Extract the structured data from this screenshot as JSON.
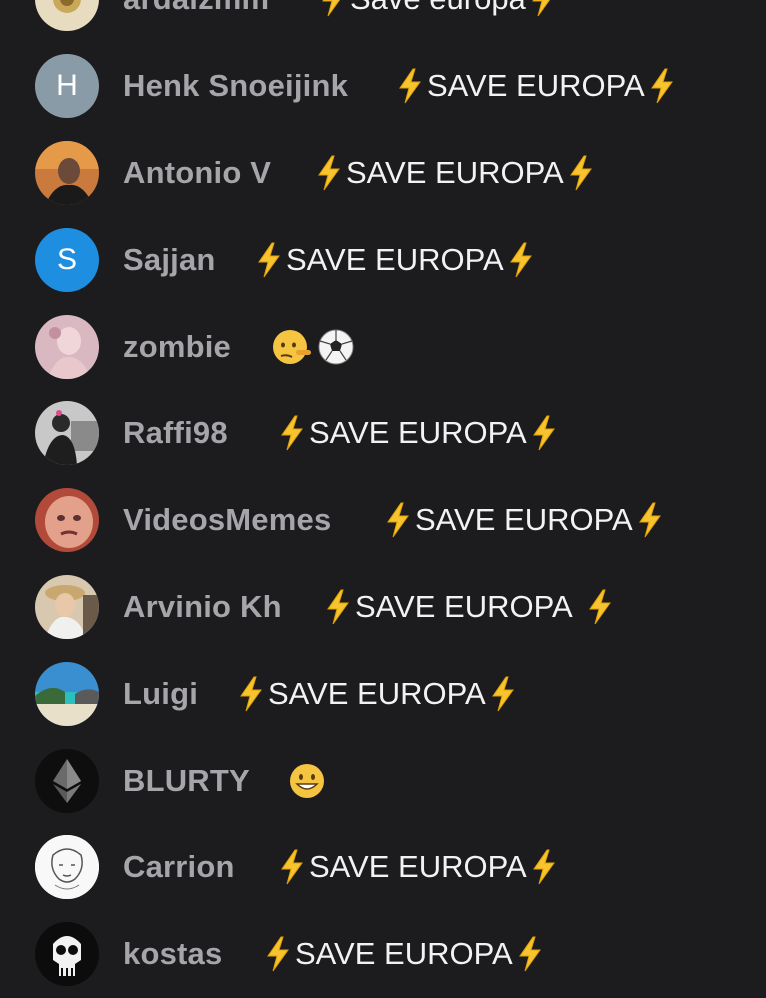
{
  "comments": [
    {
      "name": "ardaizmm",
      "message": "Save europa",
      "avatar": "photo-gold-emblem"
    },
    {
      "name": "Henk Snoeijink",
      "message": "SAVE EUROPA",
      "avatar_letter": "H",
      "avatar_color": "#8a9ba8"
    },
    {
      "name": "Antonio V",
      "message": "SAVE EUROPA",
      "avatar": "photo-man-sunset"
    },
    {
      "name": "Sajjan",
      "message": "SAVE EUROPA",
      "avatar_letter": "S",
      "avatar_color": "#1e8fe0"
    },
    {
      "name": "zombie",
      "emojis": [
        "lying-face-emoji",
        "soccer-ball-emoji"
      ],
      "avatar": "photo-pink"
    },
    {
      "name": "Raffi98",
      "message": "SAVE EUROPA",
      "avatar": "photo-person-car"
    },
    {
      "name": "VideosMemes",
      "message": "SAVE EUROPA",
      "avatar": "photo-baby-face"
    },
    {
      "name": "Arvinio Kh",
      "message": "SAVE EUROPA",
      "avatar": "photo-woman-hat"
    },
    {
      "name": "Luigi",
      "message": "SAVE EUROPA",
      "avatar": "photo-beach"
    },
    {
      "name": "BLURTY",
      "emojis": [
        "grinning-face-emoji"
      ],
      "avatar": "ethereum-logo"
    },
    {
      "name": "Carrion",
      "message": "SAVE EUROPA",
      "avatar": "sketch-drawing"
    },
    {
      "name": "kostas",
      "message": "SAVE EUROPA",
      "avatar": "punisher-skull"
    }
  ],
  "colors": {
    "background": "#1c1c1e",
    "name_text": "#a5a5aa",
    "message_text": "#f2f2f2",
    "bolt_yellow": "#f7c32e"
  }
}
